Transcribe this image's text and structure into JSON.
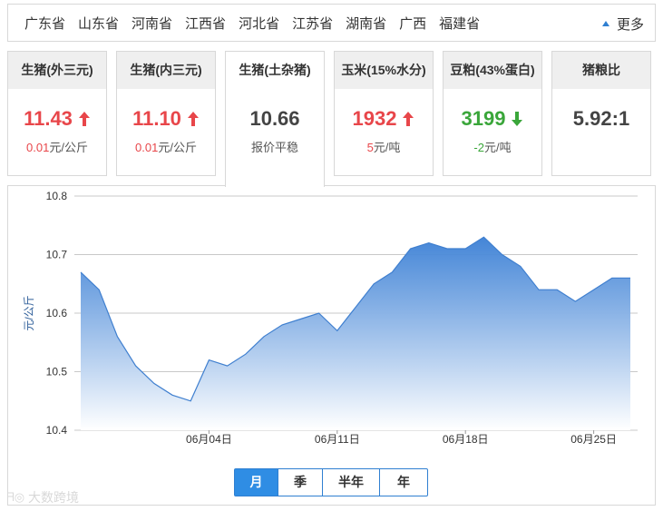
{
  "provinces": [
    "广东省",
    "山东省",
    "河南省",
    "江西省",
    "河北省",
    "江苏省",
    "湖南省",
    "广西",
    "福建省"
  ],
  "more_label": "更多",
  "cards": [
    {
      "title": "生猪(外三元)",
      "value": "11.43",
      "trend": "up",
      "change": "0.01",
      "unit": "元/公斤"
    },
    {
      "title": "生猪(内三元)",
      "value": "11.10",
      "trend": "up",
      "change": "0.01",
      "unit": "元/公斤"
    },
    {
      "title": "生猪(土杂猪)",
      "value": "10.66",
      "trend": "flat",
      "change": "",
      "unit": "报价平稳"
    },
    {
      "title": "玉米(15%水分)",
      "value": "1932",
      "trend": "up",
      "change": "5",
      "unit": "元/吨"
    },
    {
      "title": "豆粕(43%蛋白)",
      "value": "3199",
      "trend": "down",
      "change": "-2",
      "unit": "元/吨"
    },
    {
      "title": "猪粮比",
      "value": "5.92:1",
      "trend": "none",
      "change": "",
      "unit": ""
    }
  ],
  "colors": {
    "up": "#e8464a",
    "down": "#3aa63a",
    "line": "#3f7fcf",
    "fill_top": "#3a7fd5",
    "fill_bottom": "#ffffff",
    "accent": "#2f8de4"
  },
  "periods": [
    "月",
    "季",
    "半年",
    "年"
  ],
  "selected_period": "月",
  "watermark": "大数跨境",
  "chart_data": {
    "type": "area",
    "ylabel": "元/公斤",
    "ylim": [
      10.4,
      10.8
    ],
    "yticks": [
      "10.8",
      "10.7",
      "10.6",
      "10.5",
      "10.4"
    ],
    "xtick_labels": [
      "06月04日",
      "06月11日",
      "06月18日",
      "06月25日"
    ],
    "xtick_index": [
      7,
      14,
      21,
      28
    ],
    "grid": true,
    "series": [
      {
        "values": [
          10.67,
          10.64,
          10.56,
          10.51,
          10.48,
          10.46,
          10.45,
          10.52,
          10.51,
          10.53,
          10.56,
          10.58,
          10.59,
          10.6,
          10.57,
          10.61,
          10.65,
          10.67,
          10.71,
          10.72,
          10.71,
          10.71,
          10.73,
          10.7,
          10.68,
          10.64,
          10.64,
          10.62,
          10.64,
          10.66,
          10.66
        ]
      }
    ]
  }
}
